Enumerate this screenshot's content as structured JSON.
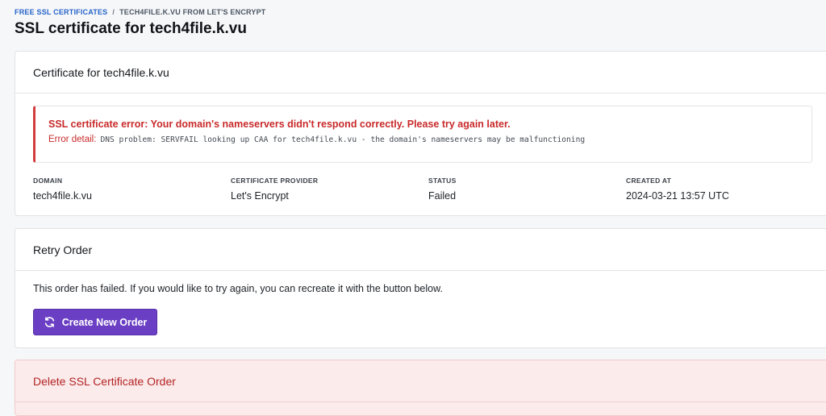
{
  "breadcrumb": {
    "root": "FREE SSL CERTIFICATES",
    "separator": "/",
    "current": "TECH4FILE.K.VU FROM LET'S ENCRYPT"
  },
  "page": {
    "title": "SSL certificate for tech4file.k.vu"
  },
  "certificate_card": {
    "header": "Certificate for tech4file.k.vu",
    "error": {
      "title": "SSL certificate error: Your domain's nameservers didn't respond correctly. Please try again later.",
      "detail_label": "Error detail:",
      "detail_code": "DNS problem: SERVFAIL looking up CAA for tech4file.k.vu - the domain's nameservers may be malfunctioning"
    },
    "meta": [
      {
        "label": "DOMAIN",
        "value": "tech4file.k.vu"
      },
      {
        "label": "CERTIFICATE PROVIDER",
        "value": "Let's Encrypt"
      },
      {
        "label": "STATUS",
        "value": "Failed"
      },
      {
        "label": "CREATED AT",
        "value": "2024-03-21 13:57 UTC"
      }
    ]
  },
  "retry_card": {
    "header": "Retry Order",
    "text": "This order has failed. If you would like to try again, you can recreate it with the button below.",
    "button_label": "Create New Order",
    "button_icon": "refresh-icon"
  },
  "delete_card": {
    "header": "Delete SSL Certificate Order"
  },
  "colors": {
    "link": "#2563c9",
    "error": "#c92a2a",
    "primary_button": "#6b3fc4",
    "danger_background": "#fbebeb"
  }
}
